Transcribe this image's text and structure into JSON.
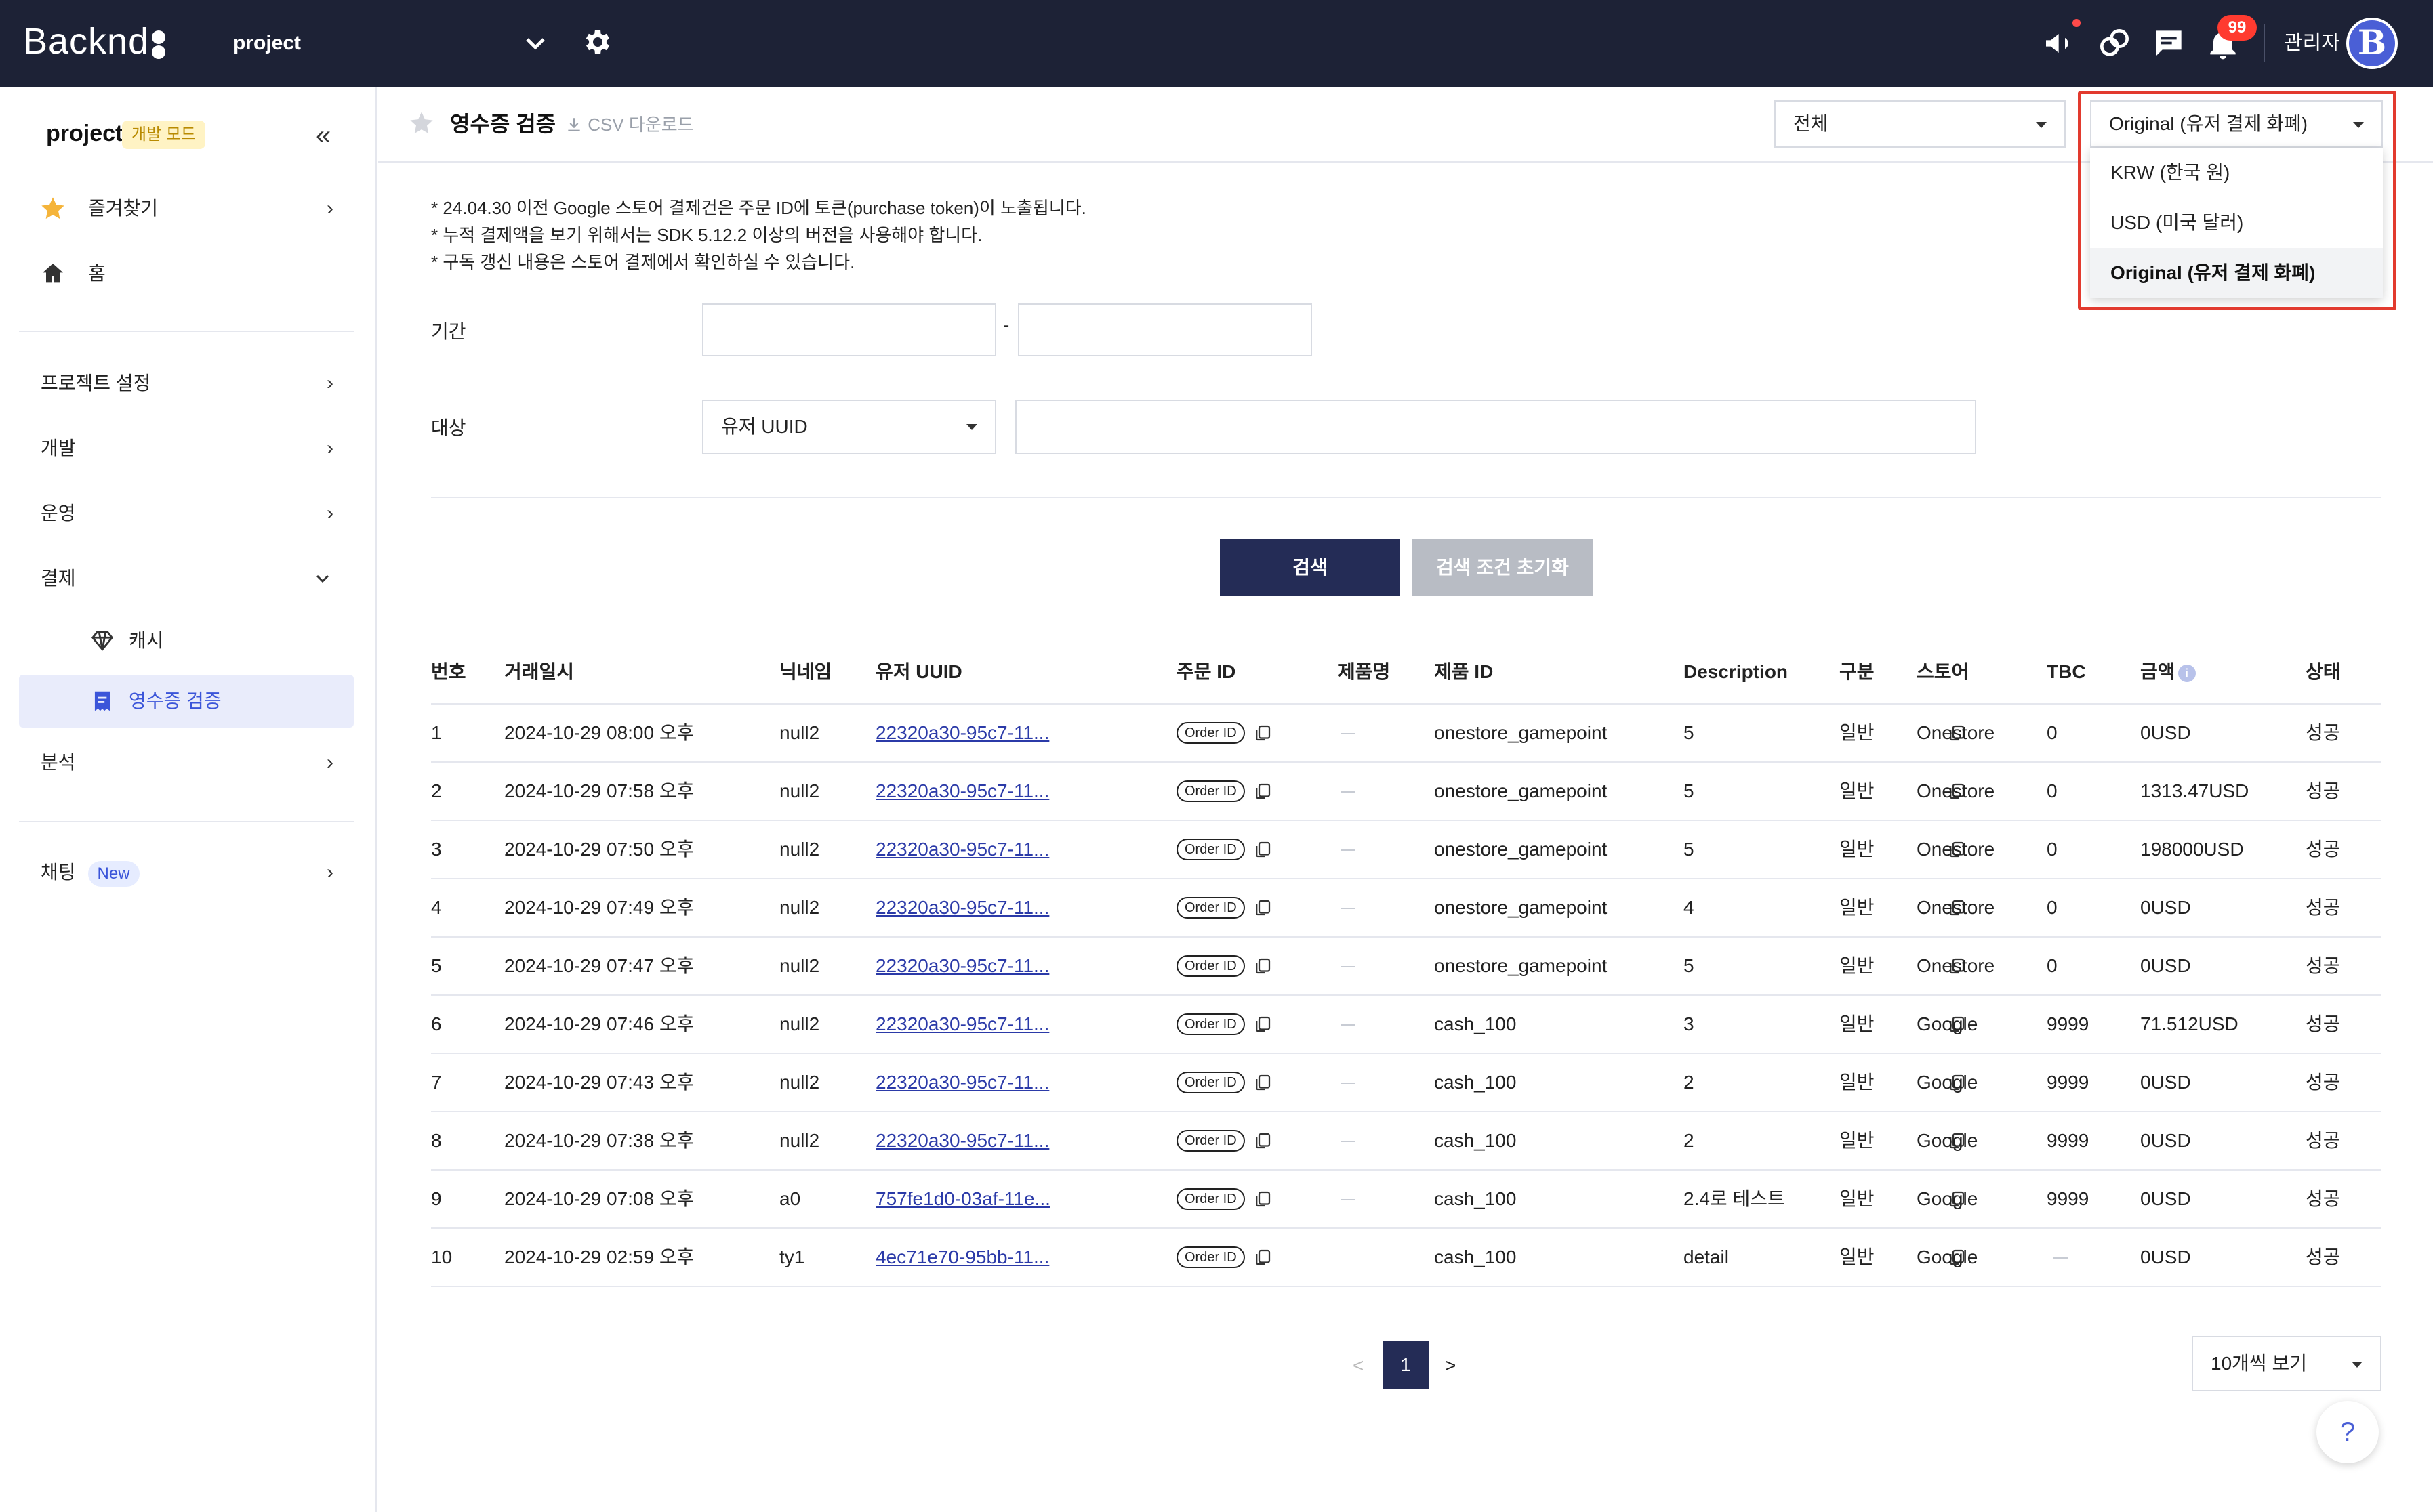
{
  "app": {
    "logo_text": "Backnd",
    "project_name": "project",
    "notification_count": "99",
    "admin_label": "관리자",
    "avatar_letter": "B"
  },
  "sidebar": {
    "project": "project",
    "mode_badge": "개발 모드",
    "items": [
      {
        "label": "즐겨찾기"
      },
      {
        "label": "홈"
      },
      {
        "label": "프로젝트 설정"
      },
      {
        "label": "개발"
      },
      {
        "label": "운영"
      },
      {
        "label": "결제"
      },
      {
        "label": "캐시"
      },
      {
        "label": "영수증 검증"
      },
      {
        "label": "분석"
      },
      {
        "label": "채팅"
      }
    ],
    "new_badge": "New"
  },
  "header": {
    "title": "영수증 검증",
    "csv_label": "CSV 다운로드",
    "filter_all": "전체",
    "currency_selected": "Original (유저 결제 화폐)"
  },
  "currency_menu": {
    "options": [
      "KRW (한국 원)",
      "USD (미국 달러)",
      "Original (유저 결제 화폐)"
    ],
    "selected_index": 2
  },
  "notes": [
    "* 24.04.30 이전 Google 스토어 결제건은 주문 ID에 토큰(purchase token)이 노출됩니다.",
    "* 누적 결제액을 보기 위해서는 SDK 5.12.2 이상의 버전을 사용해야 합니다.",
    "* 구독 갱신 내용은 스토어 결제에서 확인하실 수 있습니다."
  ],
  "form": {
    "period_label": "기간",
    "period_sep": "-",
    "target_label": "대상",
    "target_select": "유저 UUID",
    "search_button": "검색",
    "reset_button": "검색 조건 초기화"
  },
  "table": {
    "headers": [
      "번호",
      "거래일시",
      "닉네임",
      "유저 UUID",
      "주문 ID",
      "제품명",
      "제품 ID",
      "Description",
      "구분",
      "스토어",
      "TBC",
      "금액",
      "상태"
    ],
    "order_pill": "Order ID",
    "rows": [
      {
        "no": "1",
        "date": "2024-10-29 08:00 오후",
        "nick": "null2",
        "uuid": "22320a30-95c7-11...",
        "product_id": "onestore_gamepoint",
        "desc": "5",
        "type": "일반",
        "store": "Onestore",
        "tbc": "0",
        "amount": "0USD",
        "status": "성공",
        "name_dash": true,
        "tbc_dash": false
      },
      {
        "no": "2",
        "date": "2024-10-29 07:58 오후",
        "nick": "null2",
        "uuid": "22320a30-95c7-11...",
        "product_id": "onestore_gamepoint",
        "desc": "5",
        "type": "일반",
        "store": "Onestore",
        "tbc": "0",
        "amount": "1313.47USD",
        "status": "성공",
        "name_dash": true,
        "tbc_dash": false
      },
      {
        "no": "3",
        "date": "2024-10-29 07:50 오후",
        "nick": "null2",
        "uuid": "22320a30-95c7-11...",
        "product_id": "onestore_gamepoint",
        "desc": "5",
        "type": "일반",
        "store": "Onestore",
        "tbc": "0",
        "amount": "198000USD",
        "status": "성공",
        "name_dash": true,
        "tbc_dash": false
      },
      {
        "no": "4",
        "date": "2024-10-29 07:49 오후",
        "nick": "null2",
        "uuid": "22320a30-95c7-11...",
        "product_id": "onestore_gamepoint",
        "desc": "4",
        "type": "일반",
        "store": "Onestore",
        "tbc": "0",
        "amount": "0USD",
        "status": "성공",
        "name_dash": true,
        "tbc_dash": false
      },
      {
        "no": "5",
        "date": "2024-10-29 07:47 오후",
        "nick": "null2",
        "uuid": "22320a30-95c7-11...",
        "product_id": "onestore_gamepoint",
        "desc": "5",
        "type": "일반",
        "store": "Onestore",
        "tbc": "0",
        "amount": "0USD",
        "status": "성공",
        "name_dash": true,
        "tbc_dash": false
      },
      {
        "no": "6",
        "date": "2024-10-29 07:46 오후",
        "nick": "null2",
        "uuid": "22320a30-95c7-11...",
        "product_id": "cash_100",
        "desc": "3",
        "type": "일반",
        "store": "Google",
        "tbc": "9999",
        "amount": "71.512USD",
        "status": "성공",
        "name_dash": true,
        "tbc_dash": false
      },
      {
        "no": "7",
        "date": "2024-10-29 07:43 오후",
        "nick": "null2",
        "uuid": "22320a30-95c7-11...",
        "product_id": "cash_100",
        "desc": "2",
        "type": "일반",
        "store": "Google",
        "tbc": "9999",
        "amount": "0USD",
        "status": "성공",
        "name_dash": true,
        "tbc_dash": false
      },
      {
        "no": "8",
        "date": "2024-10-29 07:38 오후",
        "nick": "null2",
        "uuid": "22320a30-95c7-11...",
        "product_id": "cash_100",
        "desc": "2",
        "type": "일반",
        "store": "Google",
        "tbc": "9999",
        "amount": "0USD",
        "status": "성공",
        "name_dash": true,
        "tbc_dash": false
      },
      {
        "no": "9",
        "date": "2024-10-29 07:08 오후",
        "nick": "a0",
        "uuid": "757fe1d0-03af-11e...",
        "product_id": "cash_100",
        "desc": "2.4로 테스트",
        "type": "일반",
        "store": "Google",
        "tbc": "9999",
        "amount": "0USD",
        "status": "성공",
        "name_dash": true,
        "tbc_dash": false
      },
      {
        "no": "10",
        "date": "2024-10-29 02:59 오후",
        "nick": "ty1",
        "uuid": "4ec71e70-95bb-11...",
        "product_id": "cash_100",
        "desc": "detail",
        "type": "일반",
        "store": "Google",
        "tbc": "",
        "amount": "0USD",
        "status": "성공",
        "name_dash": false,
        "tbc_dash": true
      }
    ]
  },
  "pagination": {
    "prev": "<",
    "current": "1",
    "next": ">",
    "page_size": "10개씩 보기"
  },
  "help": "?"
}
